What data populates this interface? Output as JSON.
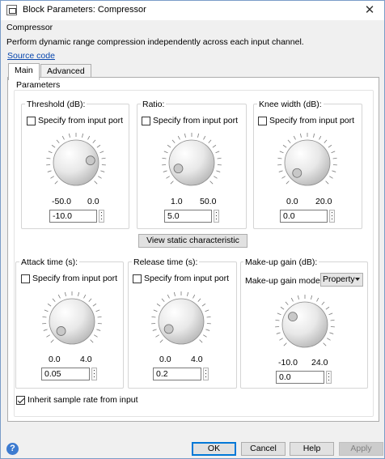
{
  "window": {
    "title": "Block Parameters: Compressor",
    "close_glyph": "✕"
  },
  "header": {
    "block_name": "Compressor",
    "description": "Perform dynamic range compression independently across each input channel.",
    "source_link": "Source code"
  },
  "tabs": [
    {
      "label": "Main",
      "active": true
    },
    {
      "label": "Advanced",
      "active": false
    }
  ],
  "parameters_label": "Parameters",
  "groups": {
    "threshold": {
      "title": "Threshold (dB):",
      "checkbox": "Specify from input port",
      "min": "-50.0",
      "max": "0.0",
      "value": "-10.0",
      "knob_level": 0.8
    },
    "ratio": {
      "title": "Ratio:",
      "checkbox": "Specify from input port",
      "min": "1.0",
      "max": "50.0",
      "value": "5.0",
      "knob_level": 0.08
    },
    "knee": {
      "title": "Knee width (dB):",
      "checkbox": "Specify from input port",
      "min": "0.0",
      "max": "20.0",
      "value": "0.0",
      "knob_level": 0.0
    },
    "attack": {
      "title": "Attack time (s):",
      "checkbox": "Specify from input port",
      "min": "0.0",
      "max": "4.0",
      "value": "0.05",
      "knob_level": 0.0125
    },
    "release": {
      "title": "Release time (s):",
      "checkbox": "Specify from input port",
      "min": "0.0",
      "max": "4.0",
      "value": "0.2",
      "knob_level": 0.05
    },
    "makeup": {
      "title": "Make-up gain (dB):",
      "mode_label": "Make-up gain mode:",
      "mode_value": "Property",
      "min": "-10.0",
      "max": "24.0",
      "value": "0.0",
      "knob_level": 0.29
    }
  },
  "view_button": "View static characteristic",
  "inherit_checkbox": {
    "label": "Inherit sample rate from input",
    "checked": true
  },
  "footer": {
    "help_glyph": "?",
    "ok": "OK",
    "cancel": "Cancel",
    "help": "Help",
    "apply": "Apply"
  },
  "colors": {
    "accent": "#0078d7",
    "link": "#0645ad",
    "help_icon": "#3d7bd0"
  }
}
